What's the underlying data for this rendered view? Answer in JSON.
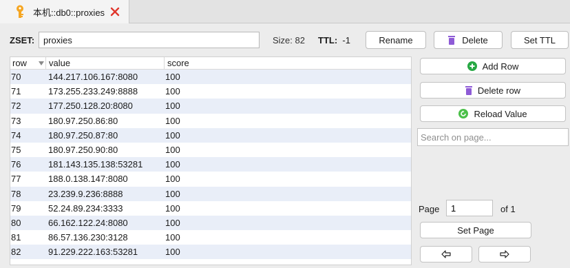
{
  "tab": {
    "title": "本机::db0::proxies",
    "accent": "#f5a623",
    "close_color": "#e0362c"
  },
  "toolbar": {
    "type_label": "ZSET:",
    "key_name": "proxies",
    "size_text": "Size: 82",
    "ttl_label": "TTL:",
    "ttl_value": "-1",
    "rename_label": "Rename",
    "delete_label": "Delete",
    "set_ttl_label": "Set TTL"
  },
  "table": {
    "columns": [
      "row",
      "value",
      "score"
    ],
    "rows": [
      {
        "row": "70",
        "value": "144.217.106.167:8080",
        "score": "100"
      },
      {
        "row": "71",
        "value": "173.255.233.249:8888",
        "score": "100"
      },
      {
        "row": "72",
        "value": "177.250.128.20:8080",
        "score": "100"
      },
      {
        "row": "73",
        "value": "180.97.250.86:80",
        "score": "100"
      },
      {
        "row": "74",
        "value": "180.97.250.87:80",
        "score": "100"
      },
      {
        "row": "75",
        "value": "180.97.250.90:80",
        "score": "100"
      },
      {
        "row": "76",
        "value": "181.143.135.138:53281",
        "score": "100"
      },
      {
        "row": "77",
        "value": "188.0.138.147:8080",
        "score": "100"
      },
      {
        "row": "78",
        "value": "23.239.9.236:8888",
        "score": "100"
      },
      {
        "row": "79",
        "value": "52.24.89.234:3333",
        "score": "100"
      },
      {
        "row": "80",
        "value": "66.162.122.24:8080",
        "score": "100"
      },
      {
        "row": "81",
        "value": "86.57.136.230:3128",
        "score": "100"
      },
      {
        "row": "82",
        "value": "91.229.222.163:53281",
        "score": "100"
      }
    ]
  },
  "side": {
    "add_row_label": "Add Row",
    "delete_row_label": "Delete row",
    "reload_label": "Reload Value",
    "search_placeholder": "Search on page...",
    "page_label": "Page",
    "page_value": "1",
    "of_label": "of 1",
    "set_page_label": "Set Page",
    "prev_icon": "arrow-left-icon",
    "next_icon": "arrow-right-icon"
  },
  "colors": {
    "add_green": "#27a844",
    "delete_purple": "#8e5bd6",
    "reload_green": "#4cc04a",
    "row_alt": "#e9eef8"
  }
}
